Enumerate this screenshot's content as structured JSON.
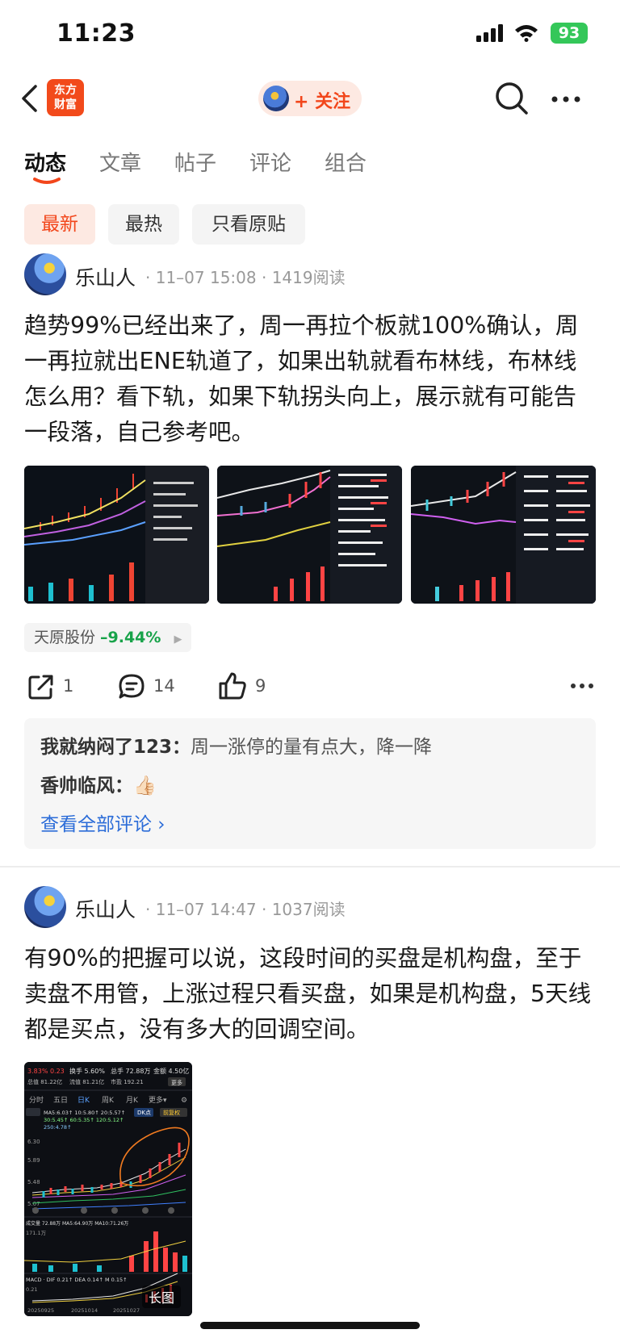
{
  "status_bar": {
    "time": "11:23",
    "battery": "93"
  },
  "header": {
    "logo_line1": "东方",
    "logo_line2": "财富",
    "follow_label": "+ 关注"
  },
  "tabs": [
    "动态",
    "文章",
    "帖子",
    "评论",
    "组合"
  ],
  "filters": [
    "最新",
    "最热",
    "只看原贴"
  ],
  "posts": [
    {
      "author": "乐山人",
      "time": "11–07 15:08",
      "reads": "1419阅读",
      "text": "趋势99%已经出来了，周一再拉个板就100%确认，周一再拉就出ENE轨道了，如果出轨就看布林线，布林线怎么用？看下轨，如果下轨拐头向上，展示就有可能告一段落，自己参考吧。",
      "stock": {
        "name": "天原股份",
        "change": "–9.44%"
      },
      "actions": {
        "share": "1",
        "comment": "14",
        "like": "9"
      },
      "comments": [
        {
          "user": "我就纳闷了123：",
          "text": "周一涨停的量有点大，降一降"
        },
        {
          "user": "香帅临风：",
          "text": "👍🏻"
        }
      ],
      "see_all": "查看全部评论 ›"
    },
    {
      "author": "乐山人",
      "time": "11–07 14:47",
      "reads": "1037阅读",
      "text": "有90%的把握可以说，这段时间的买盘是机构盘，至于卖盘不用管，上涨过程只看买盘，如果是机构盘，5天线都是买点，没有多大的回调空间。",
      "image_tag": "长图",
      "image_texts": {
        "change": "3.83%  0.23",
        "turnover": "换手 5.60%",
        "hands": "总手 72.88万",
        "amount": "金额 4.50亿",
        "cap": "总值 81.22亿",
        "float": "流值 81.21亿",
        "pe": "市盈 192.21",
        "more": "更多",
        "periods": [
          "分时",
          "五日",
          "日K",
          "周K",
          "月K",
          "更多▾"
        ],
        "ma_line1": "MA5:6.03↑  10:5.80↑  20:5.57↑",
        "ma_line2": "30:5.45↑  60:5.35↑  120:5.12↑",
        "ma_line3": "250:4.78↑",
        "dk": "DK点",
        "adj": "前复权",
        "prices": [
          "6.30",
          "5.89",
          "5.48",
          "5.07"
        ],
        "vol_label": "成交量 72.88万 MA5:64.90万 MA10:71.26万",
        "vol_max": "171.1万",
        "macd": "MACD · DIF 0.21↑ DEA 0.14↑ M 0.15↑",
        "macd_val": "0.21",
        "dates": [
          "20250925",
          "20251014",
          "20251027"
        ]
      }
    }
  ]
}
